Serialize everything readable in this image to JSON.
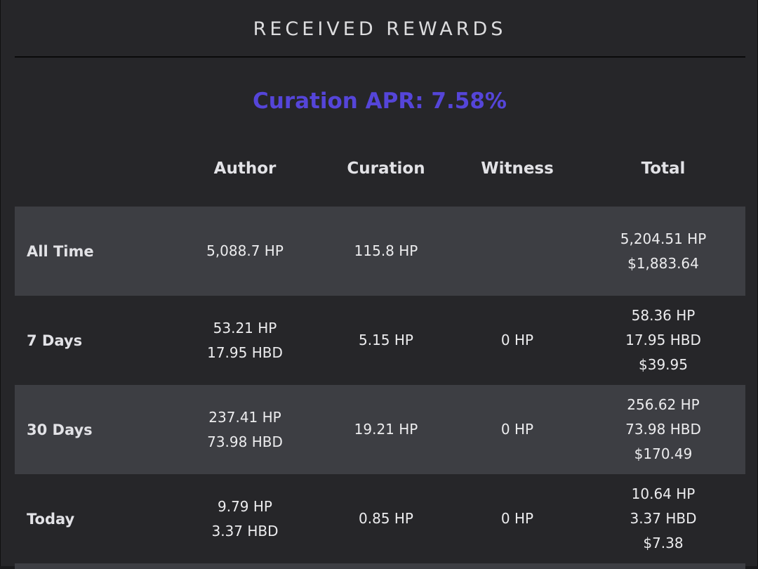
{
  "title": "RECEIVED REWARDS",
  "curation_apr": "Curation APR: 7.58%",
  "columns": {
    "author": "Author",
    "curation": "Curation",
    "witness": "Witness",
    "total": "Total"
  },
  "rows": [
    {
      "label": "All Time",
      "author": [
        "5,088.7 HP"
      ],
      "curation": [
        "115.8 HP"
      ],
      "witness": [],
      "total": [
        "5,204.51 HP",
        "$1,883.64"
      ]
    },
    {
      "label": "7 Days",
      "author": [
        "53.21 HP",
        "17.95 HBD"
      ],
      "curation": [
        "5.15 HP"
      ],
      "witness": [
        "0 HP"
      ],
      "total": [
        "58.36 HP",
        "17.95 HBD",
        "$39.95"
      ]
    },
    {
      "label": "30 Days",
      "author": [
        "237.41 HP",
        "73.98 HBD"
      ],
      "curation": [
        "19.21 HP"
      ],
      "witness": [
        "0 HP"
      ],
      "total": [
        "256.62 HP",
        "73.98 HBD",
        "$170.49"
      ]
    },
    {
      "label": "Today",
      "author": [
        "9.79 HP",
        "3.37 HBD"
      ],
      "curation": [
        "0.85 HP"
      ],
      "witness": [
        "0 HP"
      ],
      "total": [
        "10.64 HP",
        "3.37 HBD",
        "$7.38"
      ]
    }
  ],
  "colors": {
    "background": "#262629",
    "row_shaded": "#3d3e43",
    "accent": "#5545d9",
    "text": "#ececee"
  }
}
